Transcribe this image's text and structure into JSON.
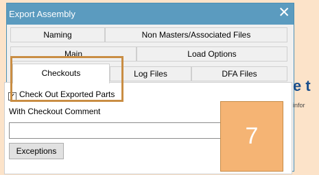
{
  "dialog": {
    "title": "Export Assembly",
    "close_glyph": "✕"
  },
  "tabs": {
    "row1": [
      "Naming",
      "Non Masters/Associated Files"
    ],
    "row2": [
      "Main",
      "Load Options"
    ],
    "row3": [
      "Checkouts",
      "Log Files",
      "DFA Files"
    ],
    "active": "Checkouts"
  },
  "checkouts": {
    "check_out_label": "Check Out Exported Parts",
    "check_out_checked": true,
    "comment_label": "With Checkout Comment",
    "comment_value": "",
    "exceptions_button": "Exceptions"
  },
  "background": {
    "heading_fragment": "e t",
    "text_fragment": "infor"
  },
  "annotation": {
    "step_number": "7",
    "highlight_color": "#c98d43",
    "badge_color": "#f5b474"
  },
  "colors": {
    "titlebar": "#5b9bbf",
    "page_background": "#fce3c9"
  }
}
